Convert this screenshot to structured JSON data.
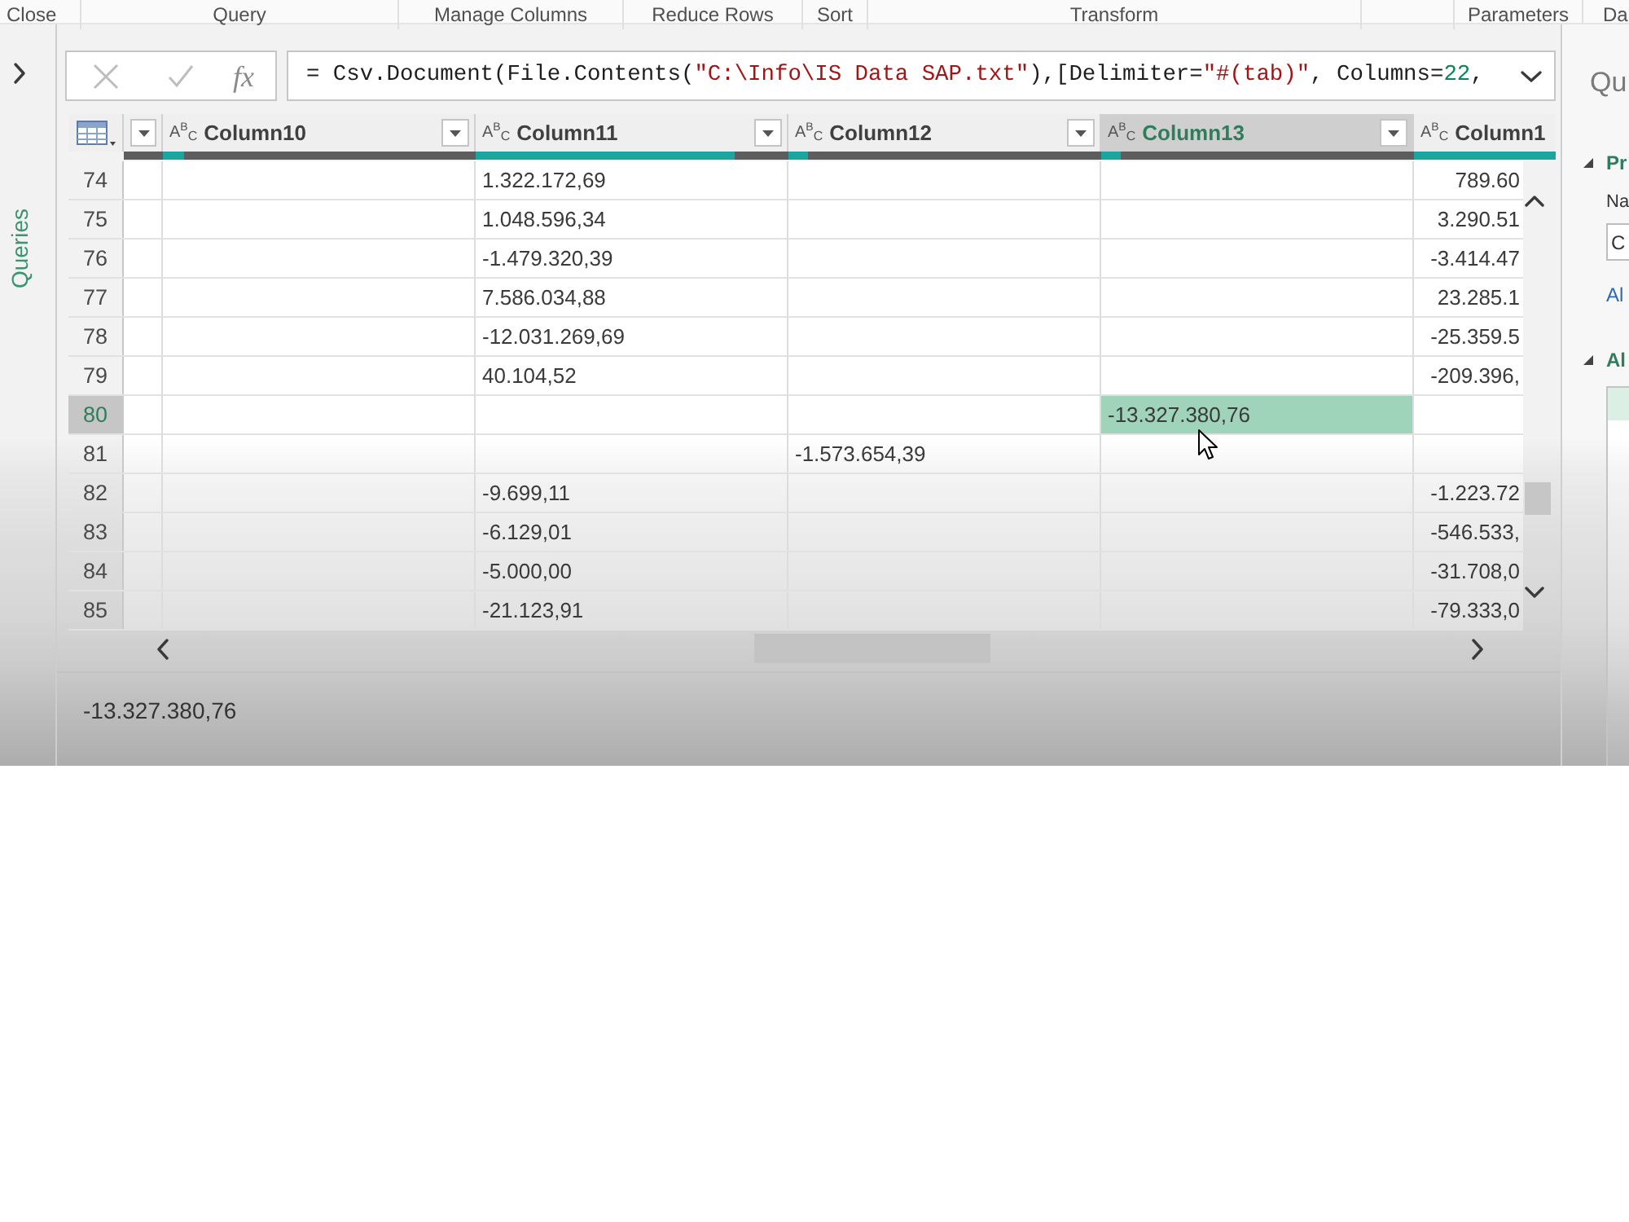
{
  "ribbon": {
    "groups": [
      "Close",
      "Query",
      "Manage Columns",
      "Reduce Rows",
      "Sort",
      "Transform",
      "Parameters",
      "Da"
    ]
  },
  "queries_pane": {
    "title": "Queries",
    "expanded": false
  },
  "formula_bar": {
    "buttons": [
      {
        "kind": "cancel",
        "disabled": true
      },
      {
        "kind": "commit",
        "disabled": true
      }
    ],
    "function_label": "fx",
    "tokens": [
      {
        "kind": "text",
        "text": "= Csv.Document(File.Contents("
      },
      {
        "kind": "string",
        "text": "\"C:\\Info\\IS Data SAP.txt\""
      },
      {
        "kind": "text",
        "text": "),[Delimiter="
      },
      {
        "kind": "string",
        "text": "\"#(tab)\""
      },
      {
        "kind": "text",
        "text": ", Columns="
      },
      {
        "kind": "number",
        "text": "22"
      },
      {
        "kind": "text",
        "text": ","
      }
    ]
  },
  "table": {
    "columns": [
      {
        "filter_button": true,
        "selected": false
      },
      {
        "type": "A$^{B}$$_{C}$",
        "label": "Column10",
        "filter_button": true,
        "level": 0.07,
        "selected": false
      },
      {
        "type": "A$^{B}$$_{C}$",
        "label": "Column11",
        "filter_button": true,
        "level": 0.83,
        "selected": false
      },
      {
        "type": "A$^{B}$$_{C}$",
        "label": "Column12",
        "filter_button": true,
        "level": 0.06,
        "selected": false
      },
      {
        "type": "A$^{B}$$_{C}$",
        "label": "Column13",
        "filter_button": true,
        "level": 0.06,
        "selected": true
      },
      {
        "type": "A$^{B}$$_{C}$",
        "label": "Column1",
        "filter_button": false,
        "level": 1,
        "selected": false
      }
    ],
    "rows": [
      {
        "number": "74",
        "selected": false,
        "cells": [
          null,
          null,
          "1.322.172,69",
          null,
          null,
          "789.60"
        ]
      },
      {
        "number": "75",
        "selected": false,
        "cells": [
          null,
          null,
          "1.048.596,34",
          null,
          null,
          "3.290.51"
        ]
      },
      {
        "number": "76",
        "selected": false,
        "cells": [
          null,
          null,
          "-1.479.320,39",
          null,
          null,
          "-3.414.47"
        ]
      },
      {
        "number": "77",
        "selected": false,
        "cells": [
          null,
          null,
          "7.586.034,88",
          null,
          null,
          "23.285.1"
        ]
      },
      {
        "number": "78",
        "selected": false,
        "cells": [
          null,
          null,
          "-12.031.269,69",
          null,
          null,
          "-25.359.5"
        ]
      },
      {
        "number": "79",
        "selected": false,
        "cells": [
          null,
          null,
          "40.104,52",
          null,
          null,
          "-209.396,"
        ]
      },
      {
        "number": "80",
        "selected": true,
        "cells": [
          null,
          null,
          null,
          null,
          "-13.327.380,76",
          null
        ]
      },
      {
        "number": "81",
        "selected": false,
        "cells": [
          null,
          null,
          null,
          "-1.573.654,39",
          null,
          null
        ]
      },
      {
        "number": "82",
        "selected": false,
        "cells": [
          null,
          null,
          "-9.699,11",
          null,
          null,
          "-1.223.72"
        ]
      },
      {
        "number": "83",
        "selected": false,
        "cells": [
          null,
          null,
          "-6.129,01",
          null,
          null,
          "-546.533,"
        ]
      },
      {
        "number": "84",
        "selected": false,
        "cells": [
          null,
          null,
          "-5.000,00",
          null,
          null,
          "-31.708,0"
        ]
      },
      {
        "number": "85",
        "selected": false,
        "cells": [
          null,
          null,
          "-21.123,91",
          null,
          null,
          "-79.333,0"
        ]
      }
    ]
  },
  "value_preview": "-13.327.380,76",
  "query_settings": {
    "title": "Qu",
    "properties": {
      "heading": "Pr",
      "expanded": true,
      "name_label": "Na",
      "name_value": "C",
      "link": "Al"
    },
    "applied_steps": {
      "heading": "Al",
      "expanded": true,
      "steps": [
        {
          "selected": true
        }
      ]
    }
  }
}
